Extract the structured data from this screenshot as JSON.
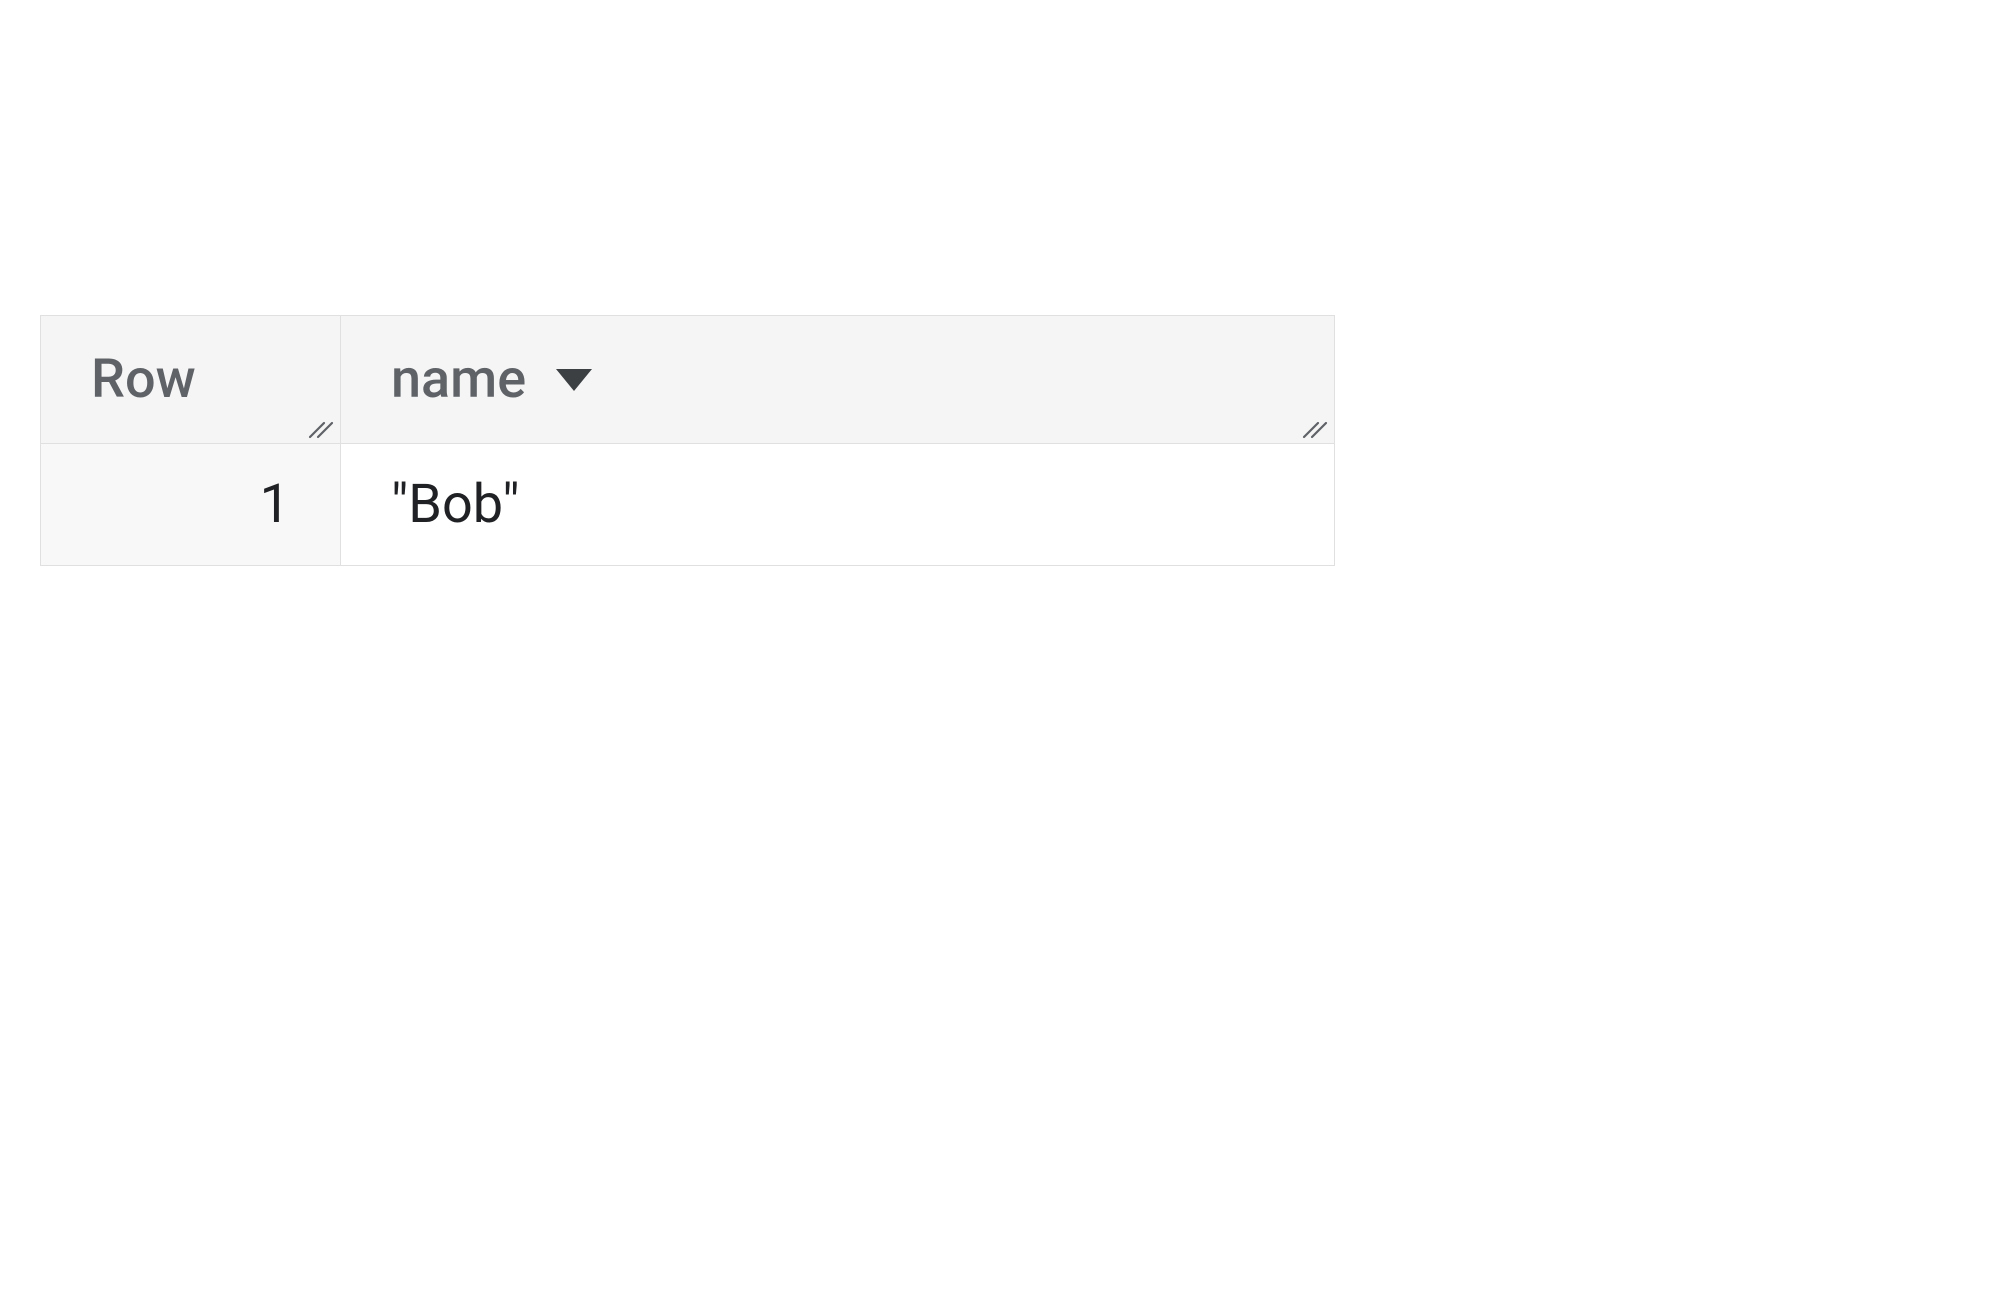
{
  "table": {
    "columns": [
      {
        "label": "Row",
        "sortable": false
      },
      {
        "label": "name",
        "sortable": true,
        "sort_dir": "desc"
      }
    ],
    "rows": [
      {
        "index": "1",
        "name": "\"Bob\""
      }
    ]
  }
}
